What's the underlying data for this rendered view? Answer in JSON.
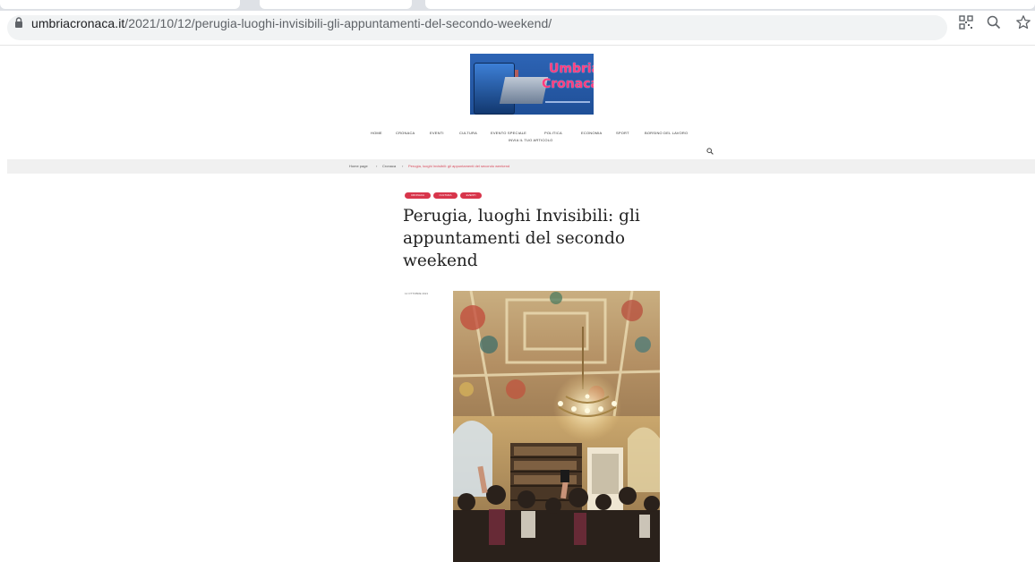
{
  "browser": {
    "url_domain": "umbriacronaca.it",
    "url_path": "/2021/10/12/perugia-luoghi-invisibili-gli-appuntamenti-del-secondo-weekend/"
  },
  "site": {
    "logo_line1": "Umbria",
    "logo_line2": "Cronaca"
  },
  "nav": {
    "items": [
      "HOME",
      "CRONACA",
      "EVENTI",
      "CULTURA",
      "EVENTO SPECIALE",
      "POLITICA",
      "ECONOMIA",
      "SPORT",
      "BORSINO DEL LAVORO",
      "INVIA IL TUO ARTICOLO"
    ]
  },
  "breadcrumb": {
    "items": [
      "Home page",
      "Cronaca",
      "Perugia, luoghi Invisibili: gli appuntamenti del secondo weekend"
    ]
  },
  "article": {
    "categories": [
      "CRONACA",
      "CULTURA",
      "EVENTI"
    ],
    "title": "Perugia, luoghi Invisibili: gli appuntamenti del secondo weekend",
    "date": "12 OTTOBRE 2021"
  },
  "colors": {
    "accent": "#d8354b",
    "breadcrumb_bg": "#f0f0f0"
  },
  "icons": [
    "lock-icon",
    "qr-code-icon",
    "zoom-icon",
    "star-icon",
    "search-icon"
  ]
}
